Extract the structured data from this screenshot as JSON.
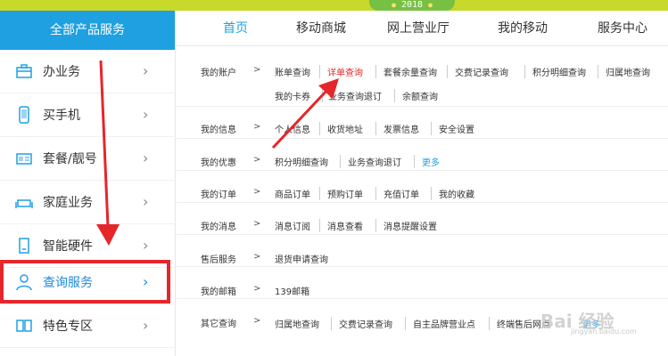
{
  "banner": {
    "year": "2018",
    "dot": "●"
  },
  "sidebar": {
    "title": "全部产品服务",
    "chevron": "›",
    "items": [
      {
        "label": "办业务",
        "icon": "briefcase-icon"
      },
      {
        "label": "买手机",
        "icon": "phone-icon"
      },
      {
        "label": "套餐/靓号",
        "icon": "sim-card-icon"
      },
      {
        "label": "家庭业务",
        "icon": "sofa-icon"
      },
      {
        "label": "智能硬件",
        "icon": "smart-device-icon"
      },
      {
        "label": "查询服务",
        "icon": "user-icon",
        "active": true
      },
      {
        "label": "特色专区",
        "icon": "feature-icon"
      }
    ]
  },
  "topnav": {
    "tabs": [
      "首页",
      "移动商城",
      "网上营业厅",
      "我的移动",
      "服务中心"
    ]
  },
  "gt": ">",
  "rows": [
    {
      "label": "我的账户",
      "links": [
        "账单查询",
        "详单查询",
        "套餐余量查询",
        "交费记录查询",
        "积分明细查询",
        "归属地查询"
      ],
      "links2": [
        "我的卡券",
        "业务查询退订",
        "余额查询"
      ]
    },
    {
      "label": "我的信息",
      "links": [
        "个人信息",
        "收货地址",
        "发票信息",
        "安全设置"
      ]
    },
    {
      "label": "我的优惠",
      "links": [
        "积分明细查询",
        "业务查询退订",
        "更多"
      ]
    },
    {
      "label": "我的订单",
      "links": [
        "商品订单",
        "预购订单",
        "充值订单",
        "我的收藏"
      ]
    },
    {
      "label": "我的消息",
      "links": [
        "消息订阅",
        "消息查看",
        "消息提醒设置"
      ]
    },
    {
      "label": "售后服务",
      "links": [
        "退货申请查询"
      ]
    },
    {
      "label": "我的邮箱",
      "links": [
        "139邮箱"
      ]
    },
    {
      "label": "其它查询",
      "links": [
        "归属地查询",
        "交费记录查询",
        "自主品牌营业点",
        "终端售后网点",
        "更多"
      ]
    }
  ],
  "watermark": {
    "text": "Bai 经验",
    "sub": "jingyan.baidu.com"
  },
  "colors": {
    "accent": "#1fa0e0",
    "highlight": "#e5262b",
    "banner": "#c7d92a"
  }
}
